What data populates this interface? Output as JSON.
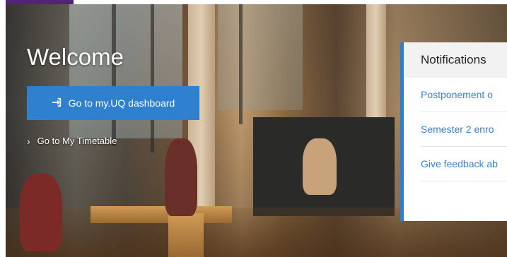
{
  "hero": {
    "title": "Welcome",
    "primary_button": {
      "label": "Go to my.UQ dashboard",
      "icon": "sign-in-icon"
    },
    "secondary_link": {
      "label": "Go to My Timetable",
      "icon": "chevron-right-icon"
    }
  },
  "notifications": {
    "title": "Notifications",
    "items": [
      {
        "label": "Postponement o"
      },
      {
        "label": "Semester 2 enro"
      },
      {
        "label": "Give feedback ab"
      }
    ]
  },
  "colors": {
    "primary_button": "#2f80cf",
    "notification_accent": "#2f7dd1",
    "link": "#3a82c9",
    "top_accent": "#51247a"
  }
}
